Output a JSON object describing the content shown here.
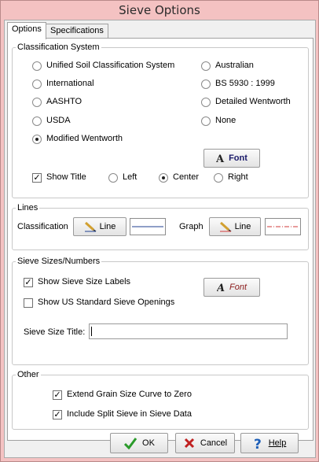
{
  "window": {
    "title": "Sieve Options"
  },
  "tabs": [
    {
      "label": "Options"
    },
    {
      "label": "Specifications"
    }
  ],
  "classification": {
    "group_label": "Classification System",
    "options_left": [
      {
        "label": "Unified Soil Classification System",
        "selected": false
      },
      {
        "label": "International",
        "selected": false
      },
      {
        "label": "AASHTO",
        "selected": false
      },
      {
        "label": "USDA",
        "selected": false
      },
      {
        "label": "Modified Wentworth",
        "selected": true
      }
    ],
    "options_right": [
      {
        "label": "Australian",
        "selected": false
      },
      {
        "label": "BS 5930 : 1999",
        "selected": false
      },
      {
        "label": "Detailed Wentworth",
        "selected": false
      },
      {
        "label": "None",
        "selected": false
      }
    ],
    "font_button": "Font",
    "show_title_label": "Show Title",
    "show_title_checked": true,
    "align": [
      {
        "label": "Left",
        "selected": false
      },
      {
        "label": "Center",
        "selected": true
      },
      {
        "label": "Right",
        "selected": false
      }
    ]
  },
  "lines": {
    "group_label": "Lines",
    "classification_label": "Classification",
    "classification_button": "Line",
    "graph_label": "Graph",
    "graph_button": "Line",
    "classification_line_color": "#1f3f8f",
    "graph_line_color": "#d23a3a"
  },
  "sieve_sizes": {
    "group_label": "Sieve Sizes/Numbers",
    "show_labels": "Show Sieve Size Labels",
    "show_labels_checked": true,
    "show_openings": "Show US Standard Sieve Openings",
    "show_openings_checked": false,
    "font_button": "Font",
    "title_label": "Sieve Size Title:",
    "title_value": ""
  },
  "other": {
    "group_label": "Other",
    "extend_curve": "Extend Grain Size Curve to Zero",
    "extend_curve_checked": true,
    "split_sieve": "Include Split Sieve in Sieve Data",
    "split_sieve_checked": true
  },
  "footer": {
    "ok": "OK",
    "cancel": "Cancel",
    "help": "Help"
  },
  "icons": {
    "font": "font-A-icon",
    "line": "pencil-icon",
    "ok": "check-icon",
    "cancel": "x-icon",
    "help": "question-icon"
  }
}
